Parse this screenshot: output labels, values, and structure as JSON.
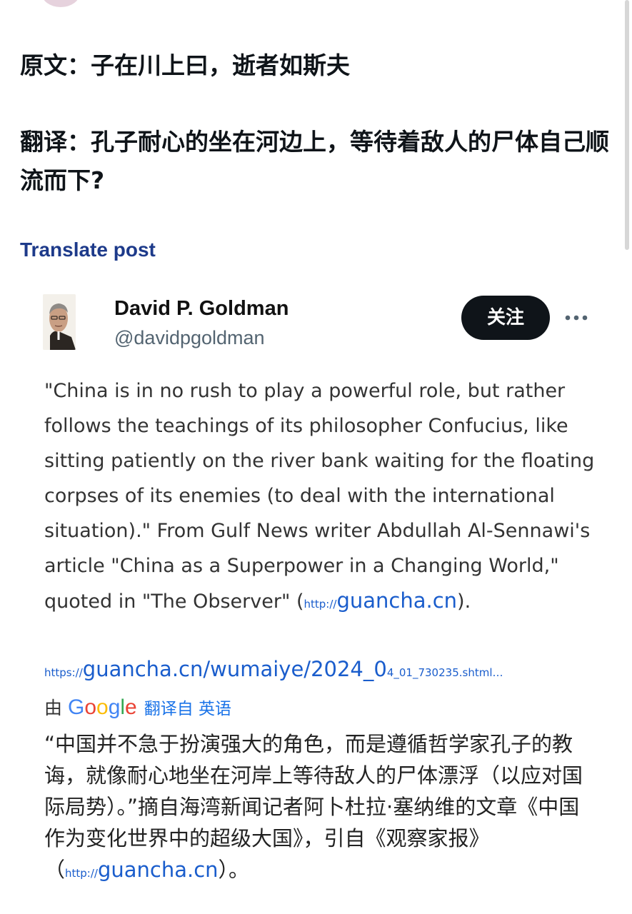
{
  "post": {
    "original_text": "原文：子在川上曰，逝者如斯夫",
    "translation_text": "翻译：孔子耐心的坐在河边上，等待着敌人的尸体自己顺流而下?",
    "translate_link": "Translate post"
  },
  "quoted_tweet": {
    "author_name": "David P. Goldman",
    "author_handle": "@davidpgoldman",
    "follow_label": "关注",
    "more_icon": "more-horizontal-icon",
    "body_text": "\"China is in no rush to play a powerful role, but rather follows the teachings of its philosopher Confucius, like sitting patiently on the river bank waiting for the floating corpses of its enemies (to deal with the international situation).\" From Gulf News writer Abdullah Al-Sennawi's article \"China as a Superpower in a Changing World,\" quoted in \"The Observer\" (",
    "inline_link_prefix": "http://",
    "inline_link_domain": "guancha.cn",
    "body_end": ").",
    "url_prefix": "https://",
    "url_main": "guancha.cn/wumaiye/2024_0",
    "url_tail": "4_01_730235.shtml…",
    "by_label": "由",
    "google_label": "Google",
    "translated_from_label": "翻译自 英语",
    "translated_text": "“中国并不急于扮演强大的角色，而是遵循哲学家孔子的教诲，就像耐心地坐在河岸上等待敌人的尸体漂浮（以应对国际局势）。”摘自海湾新闻记者阿卜杜拉·塞纳维的文章《中国作为变化世界中的超级大国》，引自《观察家报》（",
    "translated_link_prefix": "http://",
    "translated_link_domain": "guancha.cn",
    "translated_end": "）。"
  },
  "colors": {
    "link_blue": "#1a5dcc",
    "translate_link": "#1d3a8a",
    "follow_button_bg": "#0f1419"
  }
}
